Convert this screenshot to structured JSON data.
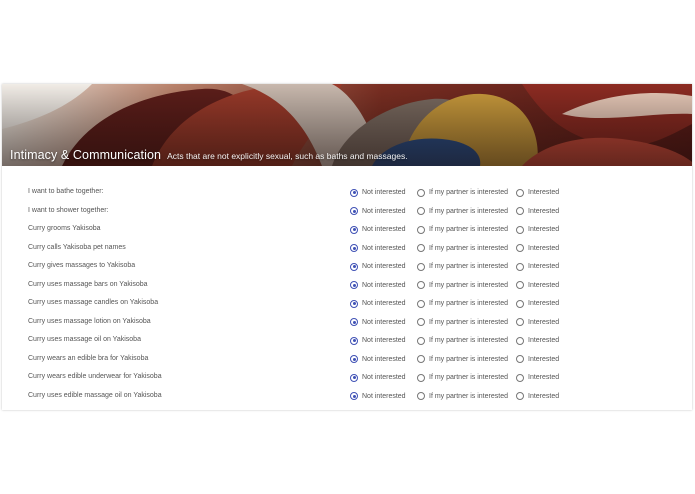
{
  "header": {
    "title": "Intimacy & Communication",
    "description": "Acts that are not explicitly sexual, such as baths and massages."
  },
  "options": [
    "Not interested",
    "If my partner is interested",
    "Interested"
  ],
  "questions": [
    {
      "label": "I want to bathe together:",
      "selected": "Not interested"
    },
    {
      "label": "I want to shower together:",
      "selected": "Not interested"
    },
    {
      "label": "Curry grooms Yakisoba",
      "selected": "Not interested"
    },
    {
      "label": "Curry calls Yakisoba pet names",
      "selected": "Not interested"
    },
    {
      "label": "Curry gives massages to Yakisoba",
      "selected": "Not interested"
    },
    {
      "label": "Curry uses massage bars on Yakisoba",
      "selected": "Not interested"
    },
    {
      "label": "Curry uses massage candles on Yakisoba",
      "selected": "Not interested"
    },
    {
      "label": "Curry uses massage lotion on Yakisoba",
      "selected": "Not interested"
    },
    {
      "label": "Curry uses massage oil on Yakisoba",
      "selected": "Not interested"
    },
    {
      "label": "Curry wears an edible bra for Yakisoba",
      "selected": "Not interested"
    },
    {
      "label": "Curry wears edible underwear for Yakisoba",
      "selected": "Not interested"
    },
    {
      "label": "Curry uses edible massage oil on Yakisoba",
      "selected": "Not interested"
    }
  ],
  "colors": {
    "accent": "#3f51b5",
    "text": "#555555"
  }
}
